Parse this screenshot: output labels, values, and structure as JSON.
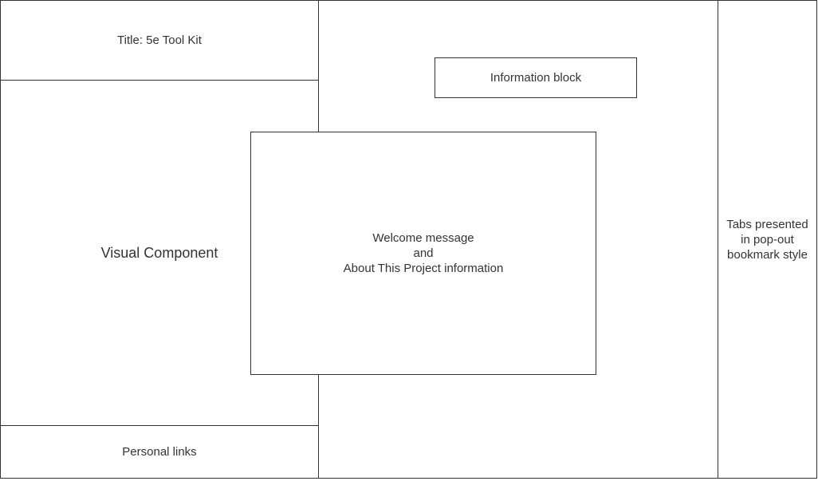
{
  "wireframe": {
    "title_block": "Title: 5e Tool Kit",
    "visual_block": "Visual Component",
    "links_block": "Personal links",
    "info_block": "Information block",
    "welcome_block": "Welcome message\nand\nAbout This Project information",
    "tabs_block": "Tabs presented\nin pop-out\nbookmark style"
  }
}
